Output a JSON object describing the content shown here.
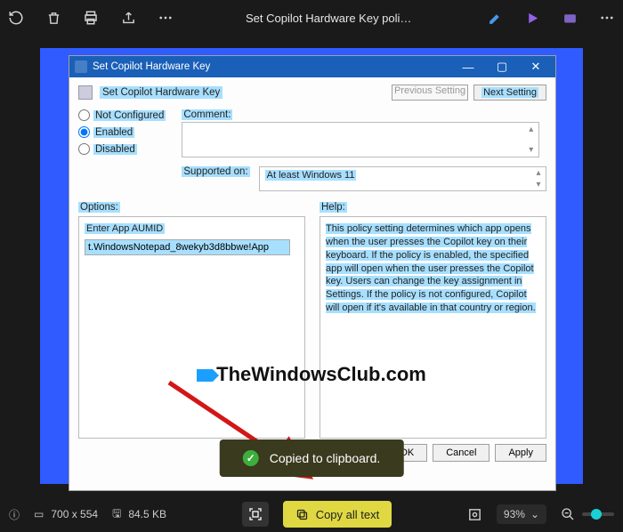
{
  "topbar": {
    "title": "Set Copilot Hardware Key polic..."
  },
  "gpo": {
    "title": "Set Copilot Hardware Key",
    "header": "Set Copilot Hardware Key",
    "prev": "Previous Setting",
    "next": "Next Setting",
    "radios": {
      "not_configured": "Not Configured",
      "enabled": "Enabled",
      "disabled": "Disabled"
    },
    "comment_label": "Comment:",
    "supported_label": "Supported on:",
    "supported_value": "At least Windows 11",
    "options_label": "Options:",
    "help_label": "Help:",
    "aumid_label": "Enter App AUMID",
    "aumid_value": "t.WindowsNotepad_8wekyb3d8bbwe!App",
    "help_text": "This policy setting determines which app opens when the user presses the Copilot key on their keyboard. If the policy is enabled, the specified app will open when the user presses the Copilot key. Users can change the key assignment in Settings. If the policy is not configured, Copilot will open if it's available in that country or region.",
    "ok": "OK",
    "cancel": "Cancel",
    "apply": "Apply"
  },
  "watermark": "TheWindowsClub.com",
  "toast": "Copied to clipboard.",
  "bottombar": {
    "dimensions": "700 x 554",
    "filesize": "84.5 KB",
    "copy_all": "Copy all text",
    "zoom": "93%"
  }
}
